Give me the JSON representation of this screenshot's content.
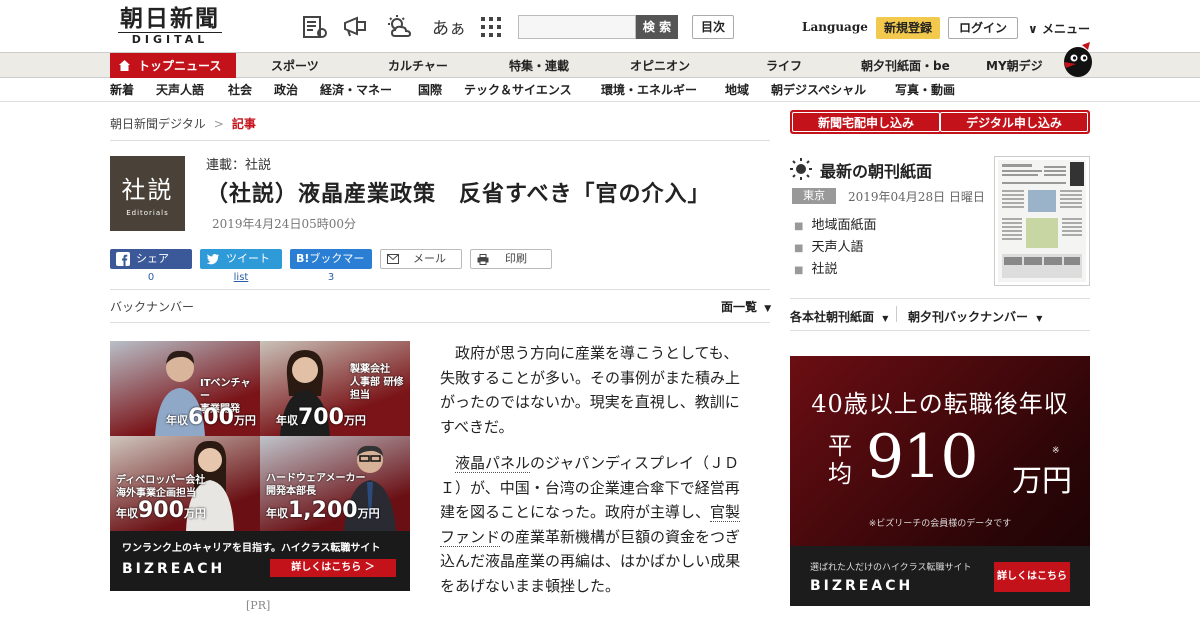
{
  "header": {
    "logo_kanji": "朝日新聞",
    "logo_sub": "DIGITAL",
    "font_size_label": "あぁ",
    "search_button": "検 索",
    "toc_button": "目次",
    "language": "Language",
    "signup": "新規登録",
    "login": "ログイン",
    "menu": "メニュー"
  },
  "nav_primary": {
    "top_news": "トップニュース",
    "items": [
      "スポーツ",
      "カルチャー",
      "特集・連載",
      "オピニオン",
      "ライフ",
      "朝夕刊紙面・be",
      "MY朝デジ"
    ]
  },
  "nav_secondary": {
    "items": [
      "新着",
      "天声人語",
      "社会",
      "政治",
      "経済・マネー",
      "国際",
      "テック＆サイエンス",
      "環境・エネルギー",
      "地域",
      "朝デジスペシャル",
      "写真・動画"
    ]
  },
  "breadcrumb": {
    "home": "朝日新聞デジタル",
    "separator": ">",
    "current": "記事"
  },
  "article": {
    "badge_main": "社説",
    "badge_sub": "Editorials",
    "series": "連載：社説",
    "title": "（社説）液晶産業政策　反省すべき「官の介入」",
    "date": "2019年4月24日05時00分",
    "social": {
      "share_label": "シェア",
      "share_count": "0",
      "tweet_label": "ツイート",
      "tweet_count": "list",
      "bookmark_label": "ブックマーク",
      "bookmark_count": "3",
      "mail_label": "メール",
      "print_label": "印刷"
    },
    "back_number": "バックナンバー",
    "page_list": "面一覧",
    "paragraphs": {
      "p1": "政府が思う方向に産業を導こうとしても、失敗することが多い。その事例がまた積み上がったのではないか。現実を直視し、教訓にすべきだ。",
      "p2_link1": "液晶パネル",
      "p2_a": "のジャパンディスプレイ（ＪＤＩ）が、中国・台湾の企業連合傘下で経営再建を図ることになった。政府が主導し、",
      "p2_link2": "官製ファンド",
      "p2_b": "の産業革新機構が巨額の資金をつぎ込んだ液晶産業の再編は、はかばかしい成果をあげないまま頓挫した。"
    }
  },
  "ad_left": {
    "cells": [
      {
        "role_line1": "ITベンチャー",
        "role_line2": "事業開発",
        "prefix": "年収",
        "amount": "600",
        "suffix": "万円"
      },
      {
        "role_line1": "製薬会社",
        "role_line2": "人事部 研修担当",
        "prefix": "年収",
        "amount": "700",
        "suffix": "万円"
      },
      {
        "role_line1": "ディベロッパー会社",
        "role_line2": "海外事業企画担当",
        "prefix": "年収",
        "amount": "900",
        "suffix": "万円"
      },
      {
        "role_line1": "ハードウェアメーカー",
        "role_line2": "開発本部長",
        "prefix": "年収",
        "amount": "1,200",
        "suffix": "万円"
      }
    ],
    "tagline": "ワンランク上のキャリアを目指す。ハイクラス転職サイト",
    "brand": "BIZREACH",
    "cta": "詳しくはこちら ＞",
    "pr_label": "[PR]"
  },
  "sidebar": {
    "subscribe_paper": "新聞宅配申し込み",
    "subscribe_digital": "デジタル申し込み",
    "paper_title": "最新の朝刊紙面",
    "edition": "東京",
    "paper_date": "2019年04月28日 日曜日",
    "links": [
      "地域面紙面",
      "天声人語",
      "社説"
    ],
    "honsha": "各本社朝刊紙面",
    "yukan": "朝夕刊バックナンバー"
  },
  "ad_right": {
    "headline": "40歳以上の転職後年収",
    "heikin": "平均",
    "amount": "910",
    "unit": "万円",
    "note_mark": "※",
    "footnote": "※ビズリーチの会員様のデータです",
    "tagline": "選ばれた人だけのハイクラス転職サイト",
    "brand": "BIZREACH",
    "cta": "詳しくはこちら"
  },
  "colors": {
    "brand_red": "#c4121b",
    "facebook": "#3b5998",
    "twitter": "#2f9ad8",
    "hatena": "#2a7fd4",
    "signup_yellow": "#f2c94c"
  }
}
